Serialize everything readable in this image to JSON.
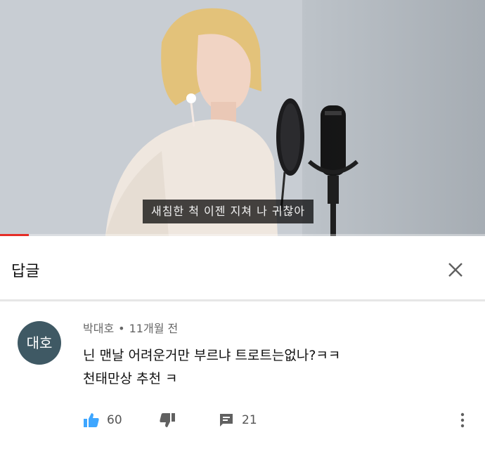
{
  "video": {
    "subtitle": "새침한 척 이젠 지쳐 나 귀찮아",
    "progress": 0.06,
    "progress_color": "#e52d27"
  },
  "panel": {
    "title": "답글",
    "close_icon": "close-icon"
  },
  "comment": {
    "avatar_text": "대호",
    "avatar_color": "#3f5964",
    "author": "박대호",
    "separator": "•",
    "time": "11개월 전",
    "text_line1": "닌 맨날 어려운거만 부르냐 트로트는없나?ㅋㅋ",
    "text_line2": "천태만상 추천 ㅋ",
    "likes": "60",
    "replies": "21",
    "accent_color": "#3ea6ff"
  }
}
